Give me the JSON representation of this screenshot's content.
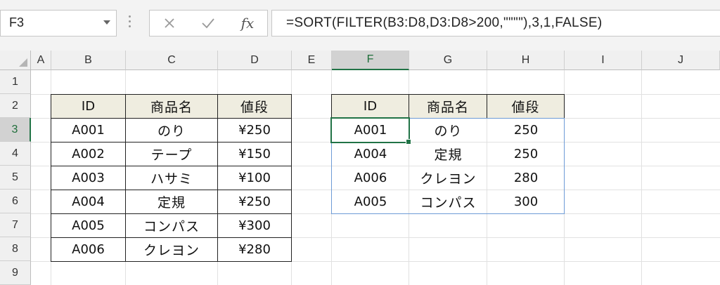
{
  "name_box": {
    "value": "F3"
  },
  "formula_bar": {
    "cancel_icon": "close-icon",
    "enter_icon": "check-icon",
    "function_label": "fx",
    "formula": "=SORT(FILTER(B3:D8,D3:D8>200,\"\"\"\"),3,1,FALSE)"
  },
  "columns": [
    "A",
    "B",
    "C",
    "D",
    "E",
    "F",
    "G",
    "H",
    "I",
    "J"
  ],
  "rows": [
    "1",
    "2",
    "3",
    "4",
    "5",
    "6",
    "7",
    "8",
    "9"
  ],
  "selected_cell": {
    "column": "F",
    "row": "3"
  },
  "source_table": {
    "headers": [
      "ID",
      "商品名",
      "値段"
    ],
    "rows": [
      [
        "A001",
        "のり",
        "¥250"
      ],
      [
        "A002",
        "テープ",
        "¥150"
      ],
      [
        "A003",
        "ハサミ",
        "¥100"
      ],
      [
        "A004",
        "定規",
        "¥250"
      ],
      [
        "A005",
        "コンパス",
        "¥300"
      ],
      [
        "A006",
        "クレヨン",
        "¥280"
      ]
    ]
  },
  "result_table": {
    "headers": [
      "ID",
      "商品名",
      "値段"
    ],
    "rows": [
      [
        "A001",
        "のり",
        "250"
      ],
      [
        "A004",
        "定規",
        "250"
      ],
      [
        "A006",
        "クレヨン",
        "280"
      ],
      [
        "A005",
        "コンパス",
        "300"
      ]
    ]
  },
  "colors": {
    "selection": "#217346",
    "spill_border": "#6d9bd6",
    "header_fill": "#efede0"
  }
}
